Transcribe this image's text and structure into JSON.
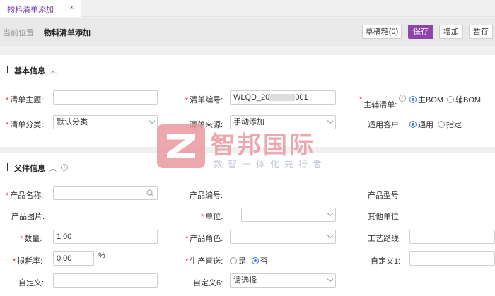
{
  "tab": {
    "label": "物料清单添加",
    "close": "×"
  },
  "header": {
    "crumb_label": "当前位置:",
    "crumb_value": "物料清单添加"
  },
  "toolbar": {
    "draft": "草稿箱(0)",
    "save": "保存",
    "add": "增加",
    "hold": "暂存"
  },
  "basic": {
    "title": "基本信息",
    "subject_label": "清单主题:",
    "code_label": "清单编号:",
    "code_prefix": "WLQD_20",
    "code_suffix": "001",
    "mainaux_label": "主辅清单:",
    "main_bom": "主BOM",
    "aux_bom": "辅BOM",
    "category_label": "清单分类:",
    "category_value": "默认分类",
    "source_label": "清单来源:",
    "source_value": "手动添加",
    "customer_label": "适用客户:",
    "customer_general": "通用",
    "customer_specified": "指定"
  },
  "parent": {
    "title": "父件信息",
    "product_name_label": "产品名称:",
    "product_code_label": "产品编号:",
    "product_model_label": "产品型号:",
    "product_image_label": "产品图片:",
    "unit_label": "单位:",
    "other_unit_label": "其他单位:",
    "qty_label": "数量:",
    "qty_value": "1.00",
    "role_label": "产品角色:",
    "route_label": "工艺路线:",
    "loss_label": "损耗率:",
    "loss_value": "0.00",
    "loss_unit": "%",
    "direct_label": "生产直送:",
    "yes": "是",
    "no": "否",
    "custom1_label": "自定义1:",
    "custom_label": "自定义:",
    "custom6_label": "自定义6:",
    "custom6_value": "请选择"
  },
  "watermark": {
    "title": "智邦国际",
    "subtitle": "数智一体化先行者"
  },
  "colors": {
    "accent": "#8e44ad",
    "required": "#e33333",
    "radio": "#3b7ddd"
  }
}
